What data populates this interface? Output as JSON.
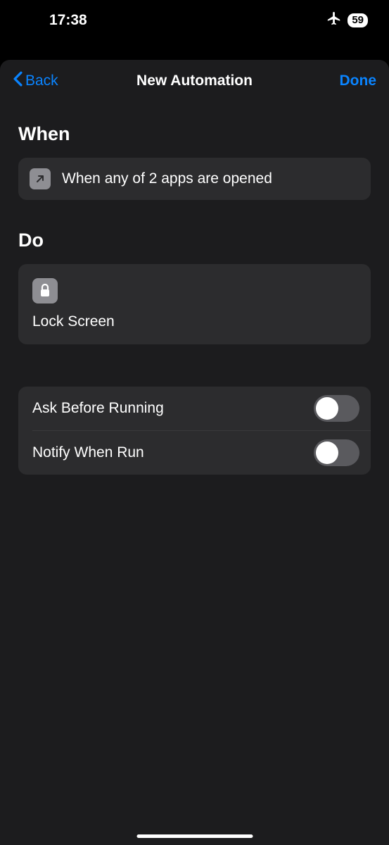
{
  "status": {
    "time": "17:38",
    "battery_percent": "59"
  },
  "nav": {
    "back_label": "Back",
    "title": "New Automation",
    "done_label": "Done"
  },
  "when": {
    "section_label": "When",
    "trigger_text": "When any of 2 apps are opened"
  },
  "do": {
    "section_label": "Do",
    "action_label": "Lock Screen"
  },
  "options": {
    "ask_before_running": {
      "label": "Ask Before Running",
      "value": false
    },
    "notify_when_run": {
      "label": "Notify When Run",
      "value": false
    }
  }
}
